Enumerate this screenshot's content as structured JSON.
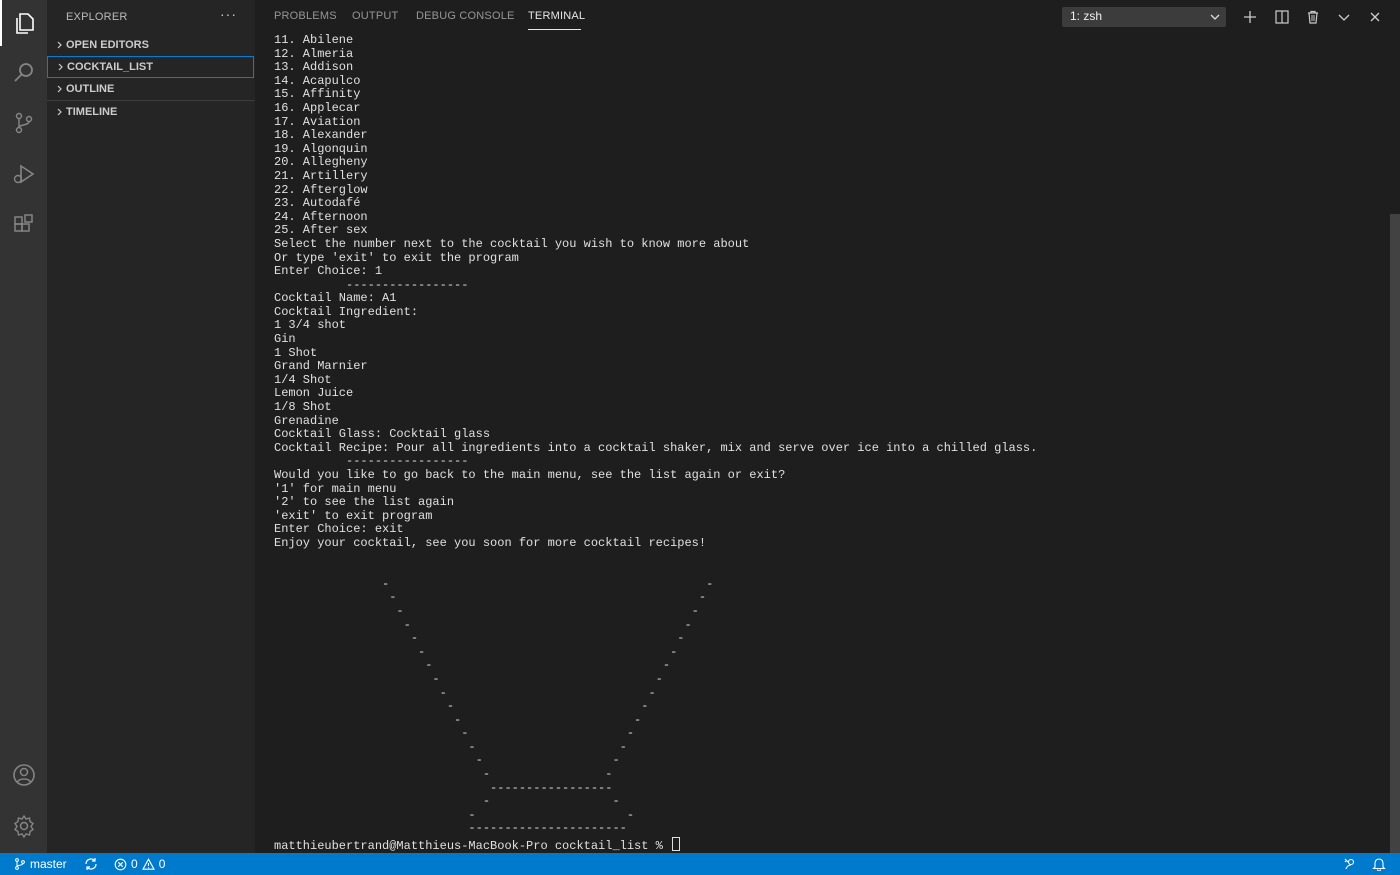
{
  "activity_bar": {
    "icons": [
      "files-icon",
      "search-icon",
      "source-control-icon",
      "run-debug-icon",
      "extensions-icon",
      "account-icon",
      "settings-gear-icon"
    ]
  },
  "sidebar": {
    "title": "EXPLORER",
    "more": "···",
    "sections": {
      "open_editors": "OPEN EDITORS",
      "cocktail_list": "COCKTAIL_LIST",
      "outline": "OUTLINE",
      "timeline": "TIMELINE"
    }
  },
  "panel": {
    "tabs": {
      "problems": "PROBLEMS",
      "output": "OUTPUT",
      "debug_console": "DEBUG CONSOLE",
      "terminal": "TERMINAL"
    },
    "active_tab": "TERMINAL",
    "terminal_select": "1: zsh"
  },
  "terminal": {
    "lines": [
      "11. Abilene",
      "12. Almeria",
      "13. Addison",
      "14. Acapulco",
      "15. Affinity",
      "16. Applecar",
      "17. Aviation",
      "18. Alexander",
      "19. Algonquin",
      "20. Allegheny",
      "21. Artillery",
      "22. Afterglow",
      "23. Autodafé",
      "24. Afternoon",
      "25. After sex",
      "Select the number next to the cocktail you wish to know more about",
      "Or type 'exit' to exit the program",
      "Enter Choice: 1",
      "          -----------------",
      "Cocktail Name: A1",
      "Cocktail Ingredient:",
      "1 3/4 shot",
      "Gin",
      "1 Shot",
      "Grand Marnier",
      "1/4 Shot",
      "Lemon Juice",
      "1/8 Shot",
      "Grenadine",
      "Cocktail Glass: Cocktail glass",
      "Cocktail Recipe: Pour all ingredients into a cocktail shaker, mix and serve over ice into a chilled glass.",
      "          -----------------",
      "Would you like to go back to the main menu, see the list again or exit?",
      "'1' for main menu",
      "'2' to see the list again",
      "'exit' to exit program",
      "Enter Choice: exit",
      "Enjoy your cocktail, see you soon for more cocktail recipes!",
      "",
      "",
      "               -                                            -",
      "                -                                          -",
      "                 -                                        -",
      "                  -                                      -",
      "                   -                                    -",
      "                    -                                  -",
      "                     -                                -",
      "                      -                              -",
      "                       -                            -",
      "                        -                          -",
      "                         -                        -",
      "                          -                      -",
      "                           -                    -",
      "                            -                  -",
      "                             -                -",
      "                              -----------------",
      "                             -                 -",
      "                           -                     -",
      "                           ----------------------"
    ],
    "prompt": "matthieubertrand@Matthieus-MacBook-Pro cocktail_list % "
  },
  "status_bar": {
    "branch": "master",
    "errors": "0",
    "warnings": "0"
  },
  "colors": {
    "accent": "#007acc",
    "activity_bar": "#333333",
    "sidebar": "#252526",
    "editor": "#1e1e1e"
  }
}
